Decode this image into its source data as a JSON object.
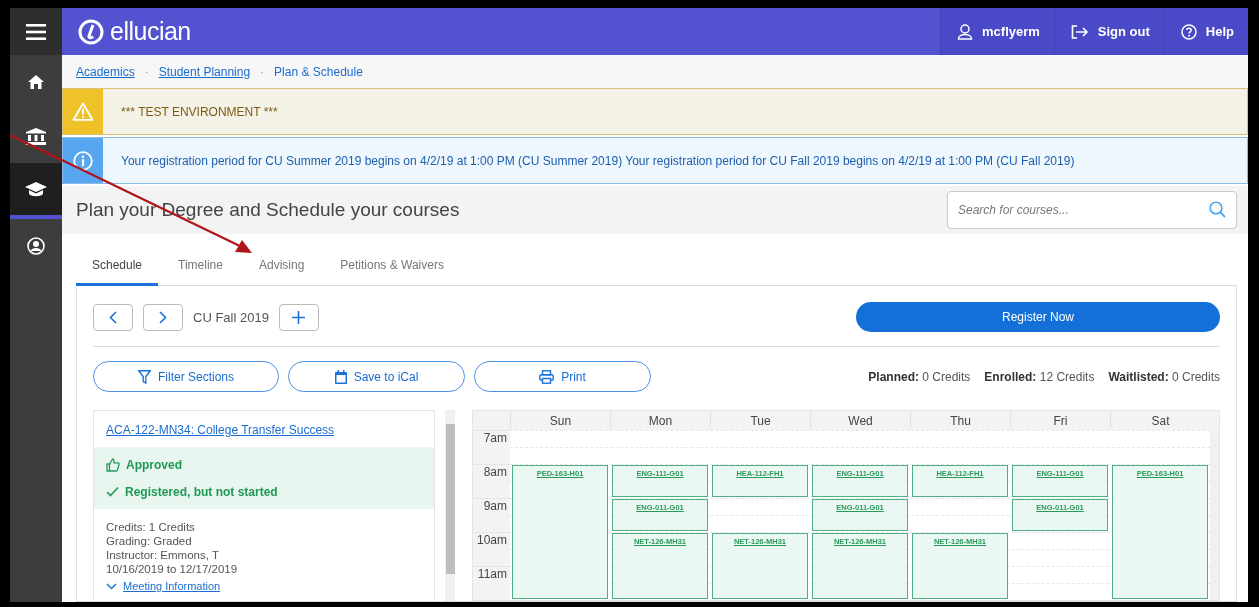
{
  "header": {
    "logo": "ellucian",
    "menu": [
      {
        "kind": "user",
        "label": "mcflyerm"
      },
      {
        "kind": "signout",
        "label": "Sign out"
      },
      {
        "kind": "help",
        "label": "Help"
      }
    ]
  },
  "sidebar": {
    "items": [
      {
        "kind": "home",
        "selected": false
      },
      {
        "kind": "institution",
        "selected": false
      },
      {
        "kind": "academics",
        "selected": true
      },
      {
        "kind": "profile",
        "selected": false
      }
    ]
  },
  "breadcrumbs": {
    "separator": "·",
    "items": [
      {
        "label": "Academics",
        "link": true
      },
      {
        "label": "Student Planning",
        "link": true
      },
      {
        "label": "Plan & Schedule",
        "link": false
      }
    ]
  },
  "alerts": [
    {
      "kind": "warning",
      "text": "*** TEST ENVIRONMENT ***"
    },
    {
      "kind": "info",
      "text": "Your registration period for CU Summer 2019 begins on 4/2/19 at 1:00 PM (CU Summer 2019) Your registration period for CU Fall 2019 begins on 4/2/19 at 1:00 PM (CU Fall 2019)"
    }
  ],
  "page_title": "Plan your Degree and Schedule your courses",
  "search": {
    "placeholder": "Search for courses..."
  },
  "tabs": [
    {
      "label": "Schedule",
      "selected": true
    },
    {
      "label": "Timeline",
      "selected": false
    },
    {
      "label": "Advising",
      "selected": false
    },
    {
      "label": "Petitions & Waivers",
      "selected": false
    }
  ],
  "term": {
    "label": "CU Fall 2019"
  },
  "register_button": "Register Now",
  "actions": [
    {
      "kind": "filter",
      "label": "Filter Sections"
    },
    {
      "kind": "calendar",
      "label": "Save to iCal"
    },
    {
      "kind": "print",
      "label": "Print"
    }
  ],
  "credits": [
    "**Planned:** 0 Credits",
    "**Enrolled:** 12 Credits",
    "**Waitlisted:** 0 Credits"
  ],
  "course": {
    "title": "ACA-122-MN34: College Transfer Success",
    "statuses": [
      {
        "kind": "approved",
        "label": "Approved"
      },
      {
        "kind": "registered",
        "label": "Registered, but not started"
      }
    ],
    "details": [
      "Credits: 1 Credits",
      "Grading: Graded",
      "Instructor: Emmons, T",
      "10/16/2019 to 12/17/2019"
    ],
    "meeting_link": "Meeting Information"
  },
  "calendar": {
    "hours": [
      "7am",
      "8am",
      "9am",
      "10am",
      "11am"
    ],
    "days": [
      {
        "name": "Sun",
        "slots": [
          {
            "kind": "free"
          },
          {
            "kind": "class",
            "label": "PED-163-H01",
            "continues": true
          },
          {
            "kind": "busy"
          },
          {
            "kind": "busy"
          },
          {
            "kind": "busy"
          }
        ]
      },
      {
        "name": "Mon",
        "slots": [
          {
            "kind": "free"
          },
          {
            "kind": "class",
            "label": "ENG-111-G01",
            "continues": false
          },
          {
            "kind": "class",
            "label": "ENG-011-G01",
            "continues": false
          },
          {
            "kind": "class",
            "label": "NET-126-MH31",
            "continues": true
          },
          {
            "kind": "busy"
          }
        ]
      },
      {
        "name": "Tue",
        "slots": [
          {
            "kind": "free"
          },
          {
            "kind": "class",
            "label": "HEA-112-FH1",
            "continues": false
          },
          {
            "kind": "free"
          },
          {
            "kind": "class",
            "label": "NET-126-MH31",
            "continues": true
          },
          {
            "kind": "busy"
          }
        ]
      },
      {
        "name": "Wed",
        "slots": [
          {
            "kind": "free"
          },
          {
            "kind": "class",
            "label": "ENG-111-G01",
            "continues": false
          },
          {
            "kind": "class",
            "label": "ENG-011-G01",
            "continues": false
          },
          {
            "kind": "class",
            "label": "NET-126-MH31",
            "continues": true
          },
          {
            "kind": "busy"
          }
        ]
      },
      {
        "name": "Thu",
        "slots": [
          {
            "kind": "free"
          },
          {
            "kind": "class",
            "label": "HEA-112-FH1",
            "continues": false
          },
          {
            "kind": "free"
          },
          {
            "kind": "class",
            "label": "NET-126-MH31",
            "continues": true
          },
          {
            "kind": "busy"
          }
        ]
      },
      {
        "name": "Fri",
        "slots": [
          {
            "kind": "free"
          },
          {
            "kind": "class",
            "label": "ENG-111-G01",
            "continues": false
          },
          {
            "kind": "class",
            "label": "ENG-011-G01",
            "continues": false
          },
          {
            "kind": "free"
          },
          {
            "kind": "free"
          }
        ]
      },
      {
        "name": "Sat",
        "slots": [
          {
            "kind": "free"
          },
          {
            "kind": "class",
            "label": "PED-163-H01",
            "continues": true
          },
          {
            "kind": "busy"
          },
          {
            "kind": "busy"
          },
          {
            "kind": "busy"
          }
        ]
      }
    ]
  }
}
